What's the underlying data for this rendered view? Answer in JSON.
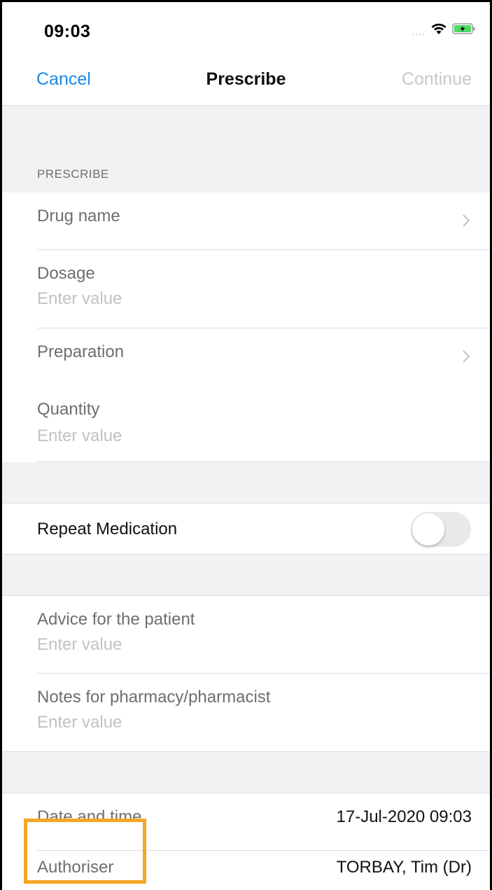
{
  "status_bar": {
    "time": "09:03",
    "signal": "....",
    "icons": [
      "wifi-icon",
      "battery-charging-icon"
    ]
  },
  "nav": {
    "cancel_label": "Cancel",
    "title": "Prescribe",
    "continue_label": "Continue"
  },
  "section": {
    "header": "PRESCRIBE"
  },
  "fields": {
    "drug_name": {
      "label": "Drug name"
    },
    "dosage": {
      "label": "Dosage",
      "placeholder": "Enter value"
    },
    "preparation": {
      "label": "Preparation"
    },
    "quantity": {
      "label": "Quantity",
      "placeholder": "Enter value"
    },
    "repeat_medication": {
      "label": "Repeat Medication",
      "enabled": false
    },
    "advice": {
      "label": "Advice for the patient",
      "placeholder": "Enter value"
    },
    "notes": {
      "label": "Notes for pharmacy/pharmacist",
      "placeholder": "Enter value"
    },
    "date_time": {
      "label": "Date and time",
      "value": "17-Jul-2020 09:03"
    },
    "authoriser": {
      "label": "Authoriser",
      "value": "TORBAY, Tim (Dr)"
    }
  },
  "colors": {
    "accent": "#1e88e5",
    "highlight": "#f5a623"
  }
}
